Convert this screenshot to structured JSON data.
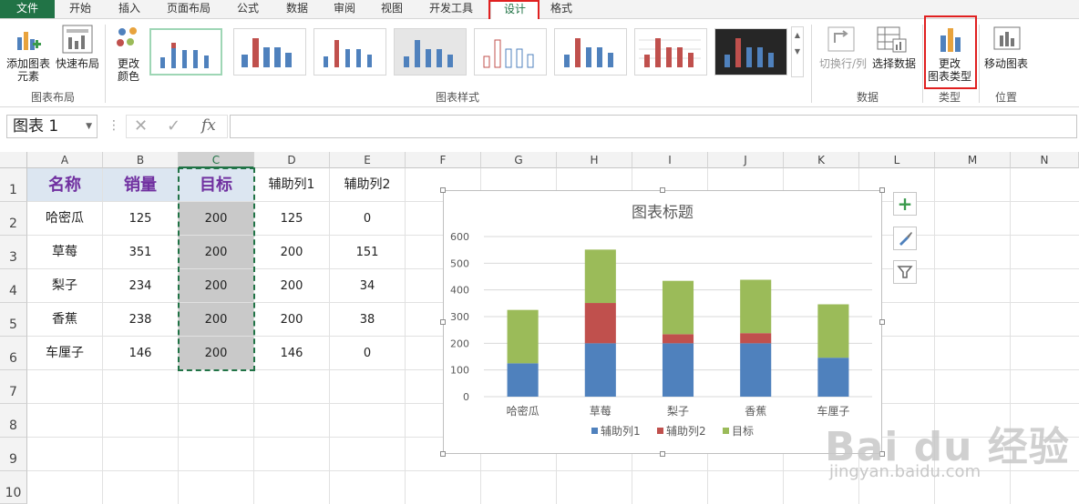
{
  "menu": {
    "tabs": [
      "文件",
      "开始",
      "插入",
      "页面布局",
      "公式",
      "数据",
      "审阅",
      "视图",
      "开发工具",
      "设计",
      "格式"
    ],
    "active": "设计"
  },
  "ribbon": {
    "add_element": "添加图表\n元素",
    "quick_layout": "快速布局",
    "group_layout": "图表布局",
    "change_color": "更改\n颜色",
    "group_styles": "图表样式",
    "switch_rowcol": "切换行/列",
    "select_data": "选择数据",
    "group_data": "数据",
    "change_type": "更改\n图表类型",
    "group_type": "类型",
    "move_chart": "移动图表",
    "group_location": "位置"
  },
  "formula_bar": {
    "name_box": "图表 1",
    "fx": "fx",
    "value": ""
  },
  "sheet": {
    "columns": [
      "A",
      "B",
      "C",
      "D",
      "E",
      "F",
      "G",
      "H",
      "I",
      "J",
      "K",
      "L",
      "M",
      "N"
    ],
    "rows": [
      "1",
      "2",
      "3",
      "4",
      "5",
      "6",
      "7",
      "8",
      "9",
      "10"
    ],
    "header": [
      "名称",
      "销量",
      "目标",
      "辅助列1",
      "辅助列2"
    ],
    "data": [
      [
        "哈密瓜",
        "125",
        "200",
        "125",
        "0"
      ],
      [
        "草莓",
        "351",
        "200",
        "200",
        "151"
      ],
      [
        "梨子",
        "234",
        "200",
        "200",
        "34"
      ],
      [
        "香蕉",
        "238",
        "200",
        "200",
        "38"
      ],
      [
        "车厘子",
        "146",
        "200",
        "146",
        "0"
      ]
    ]
  },
  "chart_data": {
    "type": "bar",
    "stacked": true,
    "title": "图表标题",
    "categories": [
      "哈密瓜",
      "草莓",
      "梨子",
      "香蕉",
      "车厘子"
    ],
    "series": [
      {
        "name": "辅助列1",
        "values": [
          125,
          200,
          200,
          200,
          146
        ],
        "color": "#4f81bd"
      },
      {
        "name": "辅助列2",
        "values": [
          0,
          151,
          34,
          38,
          0
        ],
        "color": "#c0504d"
      },
      {
        "name": "目标",
        "values": [
          200,
          200,
          200,
          200,
          200
        ],
        "color": "#9bbb59"
      }
    ],
    "ylim": [
      0,
      600
    ],
    "yticks": [
      "0",
      "100",
      "200",
      "300",
      "400",
      "500",
      "600"
    ],
    "grid": true,
    "legend": "bottom"
  },
  "watermark": {
    "main": "Bai du 经验",
    "sub": "jingyan.baidu.com"
  },
  "colors": {
    "excel_green": "#217346",
    "highlight_red": "#e02020",
    "header_fill": "#dce6f1",
    "header_text": "#7030a0"
  }
}
